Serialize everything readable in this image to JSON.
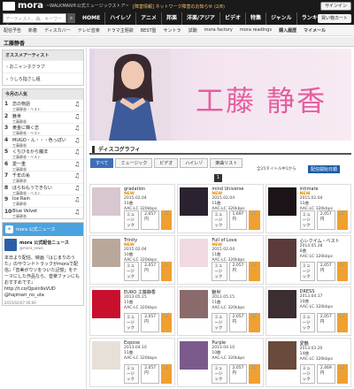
{
  "header": {
    "logo_text": "mora",
    "tagline": "~WALKMAN®公式ミュージックストア~",
    "notice": "[障害情報] ネットワーク障害のお知らせ (2/8)",
    "signin_label": "サインイン"
  },
  "search": {
    "placeholder": "アーティスト、曲、キーワード"
  },
  "nav": {
    "items": [
      "HOME",
      "ハイレゾ",
      "アニメ",
      "邦楽",
      "洋楽/アジア",
      "ビデオ",
      "特集",
      "ジャンル",
      "ランキング"
    ],
    "cart_label": "買い物カート"
  },
  "subnav": {
    "items": [
      "配信予告",
      "新着",
      "ディスカバー",
      "テレビ音楽",
      "ドラマ主題歌",
      "BEST盤",
      "サントラ",
      "試聴",
      "mora factory",
      "mora readings"
    ],
    "history_label": "購入履歴",
    "mypage_label": "マイメール"
  },
  "page_title": "工藤静香",
  "sidebar": {
    "recommend_head": "オススメアーティスト",
    "recommend_links": [
      "おニャン子クラブ",
      "うしろ指さし組"
    ],
    "ranking_head": "今月の人気",
    "ranking": [
      {
        "num": "1",
        "title": "恋の物語",
        "artist": "工藤静香・ベスト"
      },
      {
        "num": "2",
        "title": "魅世",
        "artist": "工藤静香"
      },
      {
        "num": "3",
        "title": "黄金に輝く恋",
        "artist": "工藤静香・ベスト"
      },
      {
        "num": "4",
        "title": "MUGO・ん・・・色っぽい",
        "artist": "工藤静香"
      },
      {
        "num": "5",
        "title": "くちびるから魔法",
        "artist": "工藤静香・ベスト"
      },
      {
        "num": "6",
        "title": "愛一重",
        "artist": "工藤静香"
      },
      {
        "num": "7",
        "title": "千年の糸",
        "artist": "工藤静香"
      },
      {
        "num": "8",
        "title": "ほらねもうできない",
        "artist": "工藤静香・ベスト"
      },
      {
        "num": "9",
        "title": "Ice Rain",
        "artist": "工藤静香"
      },
      {
        "num": "10",
        "title": "Blue Velvet",
        "artist": "工藤静香"
      }
    ],
    "twitter": {
      "head": "mora 公式ニュース",
      "name": "mora 公式配信ニュース",
      "handle": "@mora_news",
      "body": "本日より配信、映画『はじまりのうた』のサウンドトラックがmoraで配信♩「音美がウソをついた記憶」をテーマにした作品なら、音楽ファンにもおすすめです♩ http://t.co/Qpsln9xVUD @hajimari_no_uta",
      "date": "2015/02/07 00:00"
    }
  },
  "hero": {
    "artist_name": "工藤 静香"
  },
  "discography": {
    "heading": "ディスコグラフィ",
    "filters": [
      "すべて",
      "ミュージック",
      "ビデオ",
      "ハイレゾ",
      "楽曲リスト"
    ],
    "count_text": "全25タイトル中1から",
    "sort_label": "配信開始日順",
    "page": "1",
    "albums": [
      {
        "title": "gradation",
        "new": "NEW",
        "date": "2015.02.04",
        "tracks": "11曲",
        "format": "AAC-LC 320kbps",
        "type": "ミュージック",
        "price": "2,057円"
      },
      {
        "title": "mind Universe",
        "new": "NEW",
        "date": "2015.02.04",
        "tracks": "11曲",
        "format": "AAC-LC 320kbps",
        "type": "ミュージック",
        "price": "1,697円"
      },
      {
        "title": "intimate",
        "new": "NEW",
        "date": "2015.02.04",
        "tracks": "11曲",
        "format": "AAC-LC 320kbps",
        "type": "ミュージック",
        "price": "2,057円"
      },
      {
        "title": "Trinity",
        "new": "NEW",
        "date": "2015.02.04",
        "tracks": "10曲",
        "format": "AAC-LC 320kbps",
        "type": "ミュージック",
        "price": "2,057円"
      },
      {
        "title": "Full of Love",
        "new": "NEW",
        "date": "2015.02.04",
        "tracks": "11曲",
        "format": "AAC-LC 320kbps",
        "type": "ミュージック",
        "price": "2,057円"
      },
      {
        "title": "心レクイム・ベスト",
        "new": "",
        "date": "2014.05.28",
        "tracks": "6曲",
        "format": "AAC-LC 320kbps",
        "type": "ミュージック",
        "price": "2,057円"
      },
      {
        "title": "EURO 工藤静香",
        "new": "",
        "date": "2013.05.15",
        "tracks": "11曲",
        "format": "AAC-LC 320kbps",
        "type": "ミュージック",
        "price": "2,057円"
      },
      {
        "title": "魅世",
        "new": "",
        "date": "2013.05.15",
        "tracks": "11曲",
        "format": "AAC-LC 320kbps",
        "type": "ミュージック",
        "price": "2,057円"
      },
      {
        "title": "DRESS",
        "new": "",
        "date": "2013.04.17",
        "tracks": "10曲",
        "format": "AAC-LC 320kbps",
        "type": "ミュージック",
        "price": "2,057円"
      },
      {
        "title": "Expose",
        "new": "",
        "date": "2013.04.10",
        "tracks": "11曲",
        "format": "AAC-LC 320kbps",
        "type": "ミュージック",
        "price": "2,057円"
      },
      {
        "title": "Purple",
        "new": "",
        "date": "2013.04.10",
        "tracks": "10曲",
        "format": "AAC-LC 320kbps",
        "type": "ミュージック",
        "price": "2,057円"
      },
      {
        "title": "愛鶴",
        "new": "",
        "date": "2013.03.20",
        "tracks": "14曲",
        "format": "AAC-LC 320kbps",
        "type": "ミュージック",
        "price": "2,469円"
      }
    ]
  },
  "colors": {
    "accent": "#1e5ea8",
    "artist_name": "#e45f9f",
    "twitter": "#4aa3df"
  }
}
